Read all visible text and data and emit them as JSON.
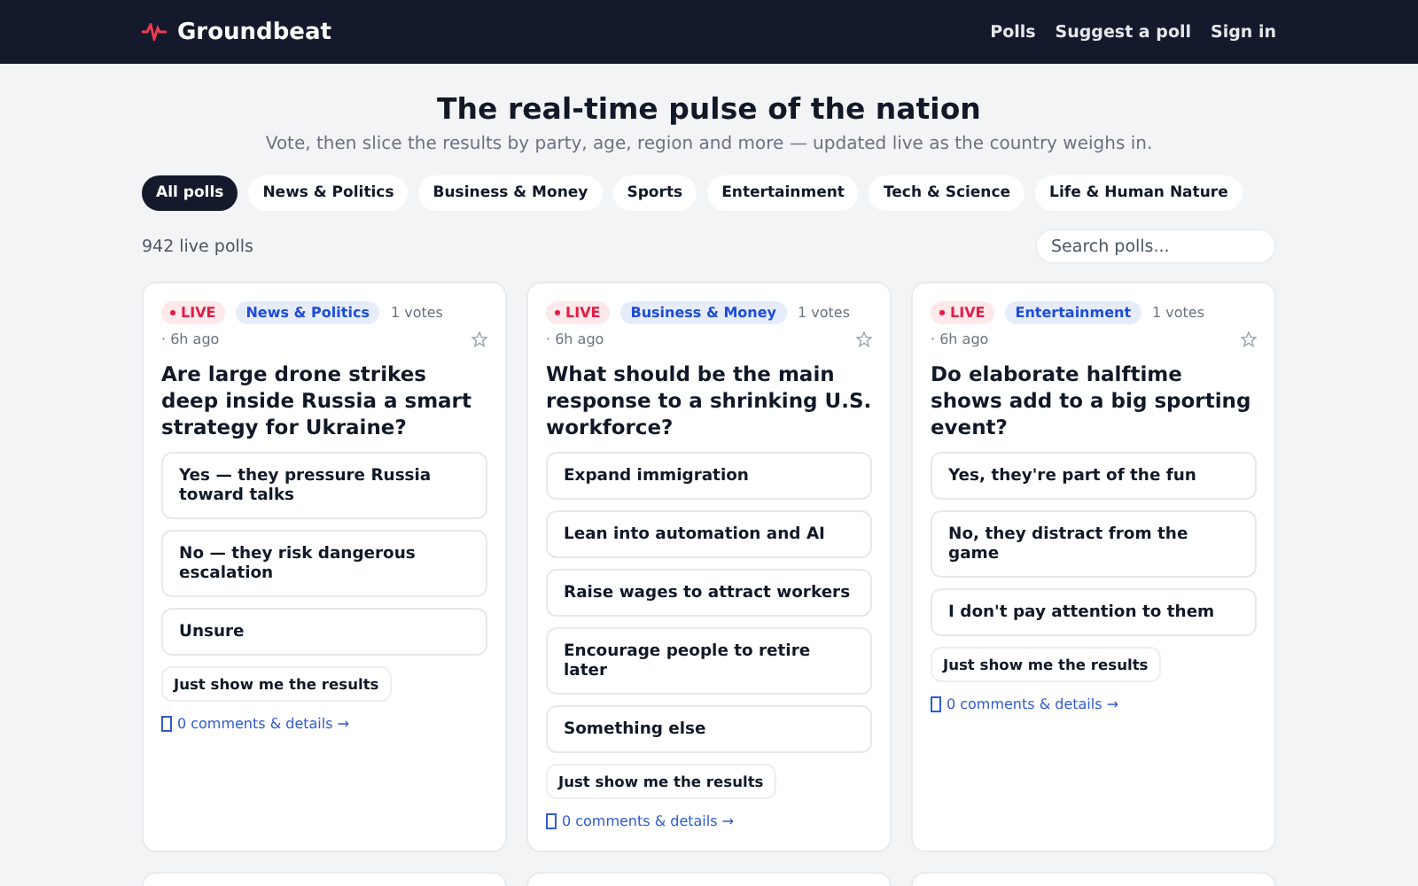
{
  "nav": {
    "brand": "Groundbeat",
    "links": [
      "Polls",
      "Suggest a poll",
      "Sign in"
    ]
  },
  "hero": {
    "title": "The real-time pulse of the nation",
    "subtitle": "Vote, then slice the results by party, age, region and more — updated live as the country weighs in."
  },
  "filters": [
    {
      "label": "All polls",
      "selected": true
    },
    {
      "label": "News & Politics",
      "selected": false
    },
    {
      "label": "Business & Money",
      "selected": false
    },
    {
      "label": "Sports",
      "selected": false
    },
    {
      "label": "Entertainment",
      "selected": false
    },
    {
      "label": "Tech & Science",
      "selected": false
    },
    {
      "label": "Life & Human Nature",
      "selected": false
    }
  ],
  "count": "942 live polls",
  "search": {
    "placeholder": "Search polls..."
  },
  "polls": [
    {
      "live": "LIVE",
      "category": "News & Politics",
      "votes": "1 votes",
      "age": "· 6h ago",
      "question": "Are large drone strikes deep inside Russia a smart strategy for Ukraine?",
      "options": [
        "Yes — they pressure Russia toward talks",
        "No — they risk dangerous escalation",
        "Unsure"
      ],
      "results_button": "Just show me the results",
      "details_link": "0 comments & details →"
    },
    {
      "live": "LIVE",
      "category": "Business & Money",
      "votes": "1 votes",
      "age": "· 6h ago",
      "question": "What should be the main response to a shrinking U.S. workforce?",
      "options": [
        "Expand immigration",
        "Lean into automation and AI",
        "Raise wages to attract workers",
        "Encourage people to retire later",
        "Something else"
      ],
      "results_button": "Just show me the results",
      "details_link": "0 comments & details →"
    },
    {
      "live": "LIVE",
      "category": "Entertainment",
      "votes": "1 votes",
      "age": "· 6h ago",
      "question": "Do elaborate halftime shows add to a big sporting event?",
      "options": [
        "Yes, they're part of the fun",
        "No, they distract from the game",
        "I don't pay attention to them"
      ],
      "results_button": "Just show me the results",
      "details_link": "0 comments & details →"
    }
  ]
}
